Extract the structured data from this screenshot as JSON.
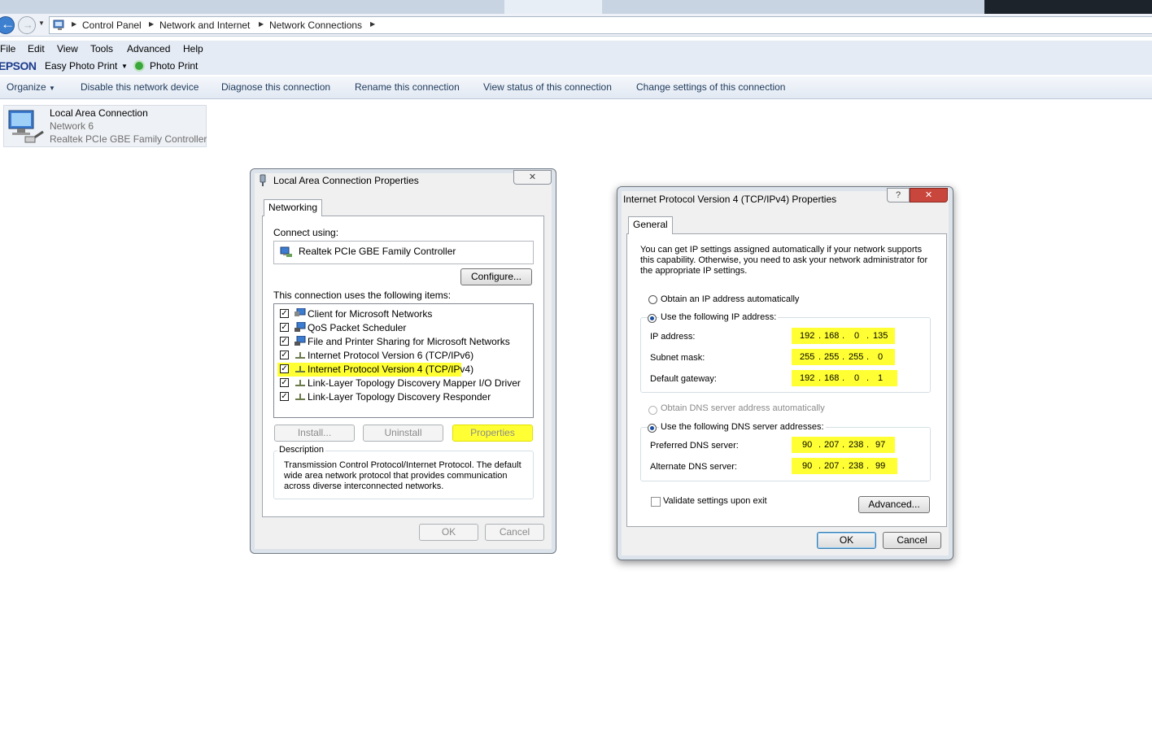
{
  "breadcrumb": [
    "Control Panel",
    "Network and Internet",
    "Network Connections"
  ],
  "menu": [
    "File",
    "Edit",
    "View",
    "Tools",
    "Advanced",
    "Help"
  ],
  "epson": {
    "logo": "EPSON",
    "easy_photo_print": "Easy Photo Print",
    "photo_print": "Photo Print"
  },
  "commands": [
    "Organize",
    "Disable this network device",
    "Diagnose this connection",
    "Rename this connection",
    "View status of this connection",
    "Change settings of this connection"
  ],
  "connection": {
    "name": "Local Area Connection",
    "network": "Network  6",
    "adapter": "Realtek PCIe GBE Family Controller"
  },
  "lac_dialog": {
    "title": "Local Area Connection Properties",
    "tab": "Networking",
    "connect_using_label": "Connect using:",
    "adapter": "Realtek PCIe GBE Family Controller",
    "configure": "Configure...",
    "items_label": "This connection uses the following items:",
    "items": [
      {
        "label": "Client for Microsoft Networks",
        "checked": true,
        "icon": "network-client-icon"
      },
      {
        "label": "QoS Packet Scheduler",
        "checked": true,
        "icon": "network-service-icon"
      },
      {
        "label": "File and Printer Sharing for Microsoft Networks",
        "checked": true,
        "icon": "network-service-icon"
      },
      {
        "label": "Internet Protocol Version 6 (TCP/IPv6)",
        "checked": true,
        "icon": "protocol-icon"
      },
      {
        "label": "Internet Protocol Version 4 (TCP/IPv4)",
        "checked": true,
        "icon": "protocol-icon",
        "selected": true
      },
      {
        "label": "Link-Layer Topology Discovery Mapper I/O Driver",
        "checked": true,
        "icon": "protocol-icon"
      },
      {
        "label": "Link-Layer Topology Discovery Responder",
        "checked": true,
        "icon": "protocol-icon"
      }
    ],
    "install": "Install...",
    "uninstall": "Uninstall",
    "properties": "Properties",
    "description_label": "Description",
    "description": "Transmission Control Protocol/Internet Protocol. The default wide area network protocol that provides communication across diverse interconnected networks.",
    "ok": "OK",
    "cancel": "Cancel"
  },
  "ipv4_dialog": {
    "title": "Internet Protocol Version 4 (TCP/IPv4) Properties",
    "help_button": "?",
    "tab": "General",
    "intro": "You can get IP settings assigned automatically if your network supports this capability. Otherwise, you need to ask your network administrator for the appropriate IP settings.",
    "obtain_ip_auto": "Obtain an IP address automatically",
    "use_following_ip": "Use the following IP address:",
    "ip_label": "IP address:",
    "ip": [
      "192",
      "168",
      "0",
      "135"
    ],
    "subnet_label": "Subnet mask:",
    "subnet": [
      "255",
      "255",
      "255",
      "0"
    ],
    "gateway_label": "Default gateway:",
    "gateway": [
      "192",
      "168",
      "0",
      "1"
    ],
    "obtain_dns_auto": "Obtain DNS server address automatically",
    "use_following_dns": "Use the following DNS server addresses:",
    "preferred_dns_label": "Preferred DNS server:",
    "preferred_dns": [
      "90",
      "207",
      "238",
      "97"
    ],
    "alternate_dns_label": "Alternate DNS server:",
    "alternate_dns": [
      "90",
      "207",
      "238",
      "99"
    ],
    "validate": "Validate settings upon exit",
    "advanced": "Advanced...",
    "ok": "OK",
    "cancel": "Cancel"
  },
  "colors": {
    "highlight": "#ffff33",
    "command_text": "#1e395b",
    "epson_blue": "#1d3c8c"
  }
}
